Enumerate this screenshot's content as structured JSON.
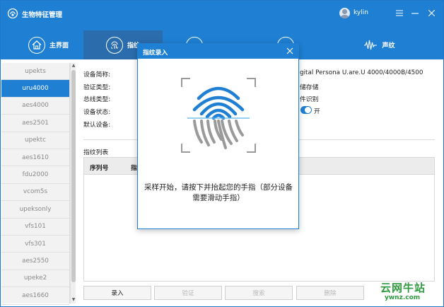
{
  "app": {
    "title": "生物特征管理",
    "user": "kylin"
  },
  "nav": {
    "tabs": [
      {
        "label": "主界面",
        "icon": "home-icon"
      },
      {
        "label": "指纹",
        "icon": "fingerprint-icon"
      },
      {
        "label": "",
        "icon": "fingervein-icon"
      },
      {
        "label": "",
        "icon": "iris-icon"
      },
      {
        "label": "声纹",
        "icon": "voiceprint-icon"
      }
    ],
    "active": 1
  },
  "sidebar": {
    "items": [
      "upekts",
      "uru4000",
      "aes4000",
      "aes2501",
      "upektc",
      "aes1610",
      "fdu2000",
      "vcom5s",
      "upeksonly",
      "vfs101",
      "vfs301",
      "aes2550",
      "upeke2",
      "aes1660"
    ],
    "selected": 1
  },
  "device_info": {
    "labels": [
      "设备简称:",
      "验证类型:",
      "总线类型:",
      "设备状态:",
      "默认设备:"
    ],
    "values": [
      "gital Persona U.are.U 4000/4000B/4500",
      "储存储",
      "件识别"
    ],
    "toggle_label": "开"
  },
  "list": {
    "title": "指纹列表",
    "columns": [
      "序列号",
      "指"
    ]
  },
  "buttons": [
    {
      "label": "录入",
      "enabled": true
    },
    {
      "label": "验证",
      "enabled": false
    },
    {
      "label": "搜索",
      "enabled": false
    },
    {
      "label": "删除",
      "enabled": false
    }
  ],
  "dialog": {
    "title": "指纹录入",
    "message": "采样开始，请按下并抬起您的手指（部分设备需要滑动手指）"
  },
  "watermark": {
    "main": "云网牛站",
    "sub": "ywnz.com"
  },
  "colors": {
    "accent": "#1f7fd3",
    "active_tab": "#2b6cad",
    "watermark": "#2f9a3e"
  }
}
